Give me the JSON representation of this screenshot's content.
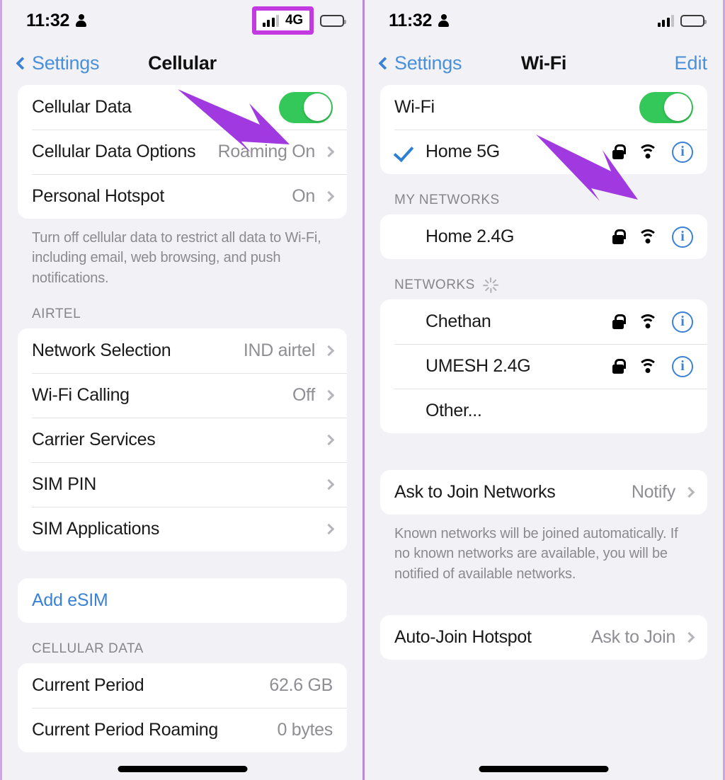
{
  "left": {
    "status": {
      "time": "11:32",
      "network_label": "4G",
      "person_icon": "person-icon",
      "signal_icon": "signal-bars-icon",
      "battery_icon": "battery-icon"
    },
    "nav": {
      "back_label": "Settings",
      "title": "Cellular"
    },
    "group1": [
      {
        "label": "Cellular Data",
        "control": "toggle",
        "value": ""
      },
      {
        "label": "Cellular Data Options",
        "value": "Roaming On",
        "control": "chevron"
      },
      {
        "label": "Personal Hotspot",
        "value": "On",
        "control": "chevron"
      }
    ],
    "footnote1": "Turn off cellular data to restrict all data to Wi-Fi, including email, web browsing, and push notifications.",
    "section_airtel": "AIRTEL",
    "group2": [
      {
        "label": "Network Selection",
        "value": "IND airtel",
        "control": "chevron"
      },
      {
        "label": "Wi-Fi Calling",
        "value": "Off",
        "control": "chevron"
      },
      {
        "label": "Carrier Services",
        "value": "",
        "control": "chevron"
      },
      {
        "label": "SIM PIN",
        "value": "",
        "control": "chevron"
      },
      {
        "label": "SIM Applications",
        "value": "",
        "control": "chevron"
      }
    ],
    "group3": [
      {
        "label": "Add eSIM",
        "value": "",
        "control": "none"
      }
    ],
    "section_cellular_data": "CELLULAR DATA",
    "group4": [
      {
        "label": "Current Period",
        "value": "62.6 GB",
        "control": "none"
      },
      {
        "label": "Current Period Roaming",
        "value": "0 bytes",
        "control": "none"
      }
    ]
  },
  "right": {
    "status": {
      "time": "11:32",
      "person_icon": "person-icon",
      "signal_icon": "signal-bars-icon",
      "battery_icon": "battery-icon"
    },
    "nav": {
      "back_label": "Settings",
      "title": "Wi-Fi",
      "edit_label": "Edit"
    },
    "group1": {
      "toggle_row": {
        "label": "Wi-Fi"
      },
      "connected": {
        "label": "Home 5G",
        "connected": true,
        "icons": [
          "lock-icon",
          "wifi-icon",
          "info-icon"
        ]
      }
    },
    "section_my_networks": "MY NETWORKS",
    "my_networks": [
      {
        "label": "Home 2.4G",
        "icons": [
          "lock-icon",
          "wifi-icon",
          "info-icon"
        ]
      }
    ],
    "section_networks": "NETWORKS",
    "networks": [
      {
        "label": "Chethan",
        "icons": [
          "lock-icon",
          "wifi-icon",
          "info-icon"
        ]
      },
      {
        "label": "UMESH 2.4G",
        "icons": [
          "lock-icon",
          "wifi-icon",
          "info-icon"
        ]
      },
      {
        "label": "Other...",
        "icons": []
      }
    ],
    "group_ask": [
      {
        "label": "Ask to Join Networks",
        "value": "Notify",
        "control": "chevron"
      }
    ],
    "footnote": "Known networks will be joined automatically. If no known networks are available, you will be notified of available networks.",
    "group_hotspot": [
      {
        "label": "Auto-Join Hotspot",
        "value": "Ask to Join",
        "control": "chevron"
      }
    ]
  },
  "annotations": {
    "highlight_color": "#c33ae0",
    "arrow_color": "#a03ae0",
    "left_arrow": "arrow-pointing-to-cellular-data-toggle",
    "right_arrow": "arrow-pointing-to-wifi-network-icons",
    "highlight_box": "highlight-box-around-4g-indicator"
  }
}
